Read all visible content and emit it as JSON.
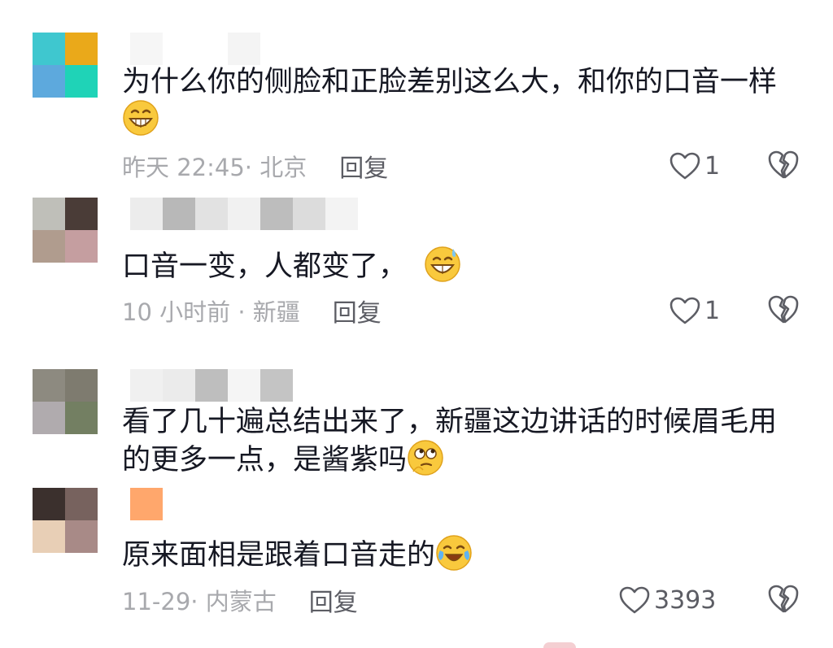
{
  "comments": [
    {
      "text": "为什么你的侧脸和正脸差别这么大，和你的口音一样",
      "emoji": "grinning-face-emoji",
      "meta": "昨天 22:45· 北京",
      "reply": "回复",
      "likes": "1",
      "avatar_colors": [
        "#3fc7cf",
        "#eaa91a",
        "#5da9dd",
        "#1fd3b7"
      ]
    },
    {
      "text": "口音一变，人都变了，",
      "emoji": "grinning-sweat-emoji",
      "meta": "10 小时前 · 新疆",
      "reply": "回复",
      "likes": "1",
      "avatar_colors": [
        "#bfbfb9",
        "#4a3c37",
        "#b09c8e",
        "#c59ea0"
      ]
    },
    {
      "text": "看了几十遍总结出来了，新疆这边讲话的时候眉毛用的更多一点，是酱紫吗",
      "emoji": "thinking-rolling-eyes-emoji",
      "avatar_colors": [
        "#8d8a80",
        "#7e7b6f",
        "#b0abae",
        "#737f62"
      ]
    },
    {
      "text": "原来面相是跟着口音走的",
      "emoji": "tears-of-joy-emoji",
      "meta": "11-29· 内蒙古",
      "reply": "回复",
      "likes": "3393",
      "avatar_colors": [
        "#3b302d",
        "#77625e",
        "#e8cfb6",
        "#a88a87"
      ]
    }
  ],
  "colors": {
    "text": "#161823",
    "meta": "#a8a9ad",
    "action": "#5c5d64",
    "icon_stroke": "#5c5d64",
    "emoji_yellow": "#f9c93d"
  }
}
